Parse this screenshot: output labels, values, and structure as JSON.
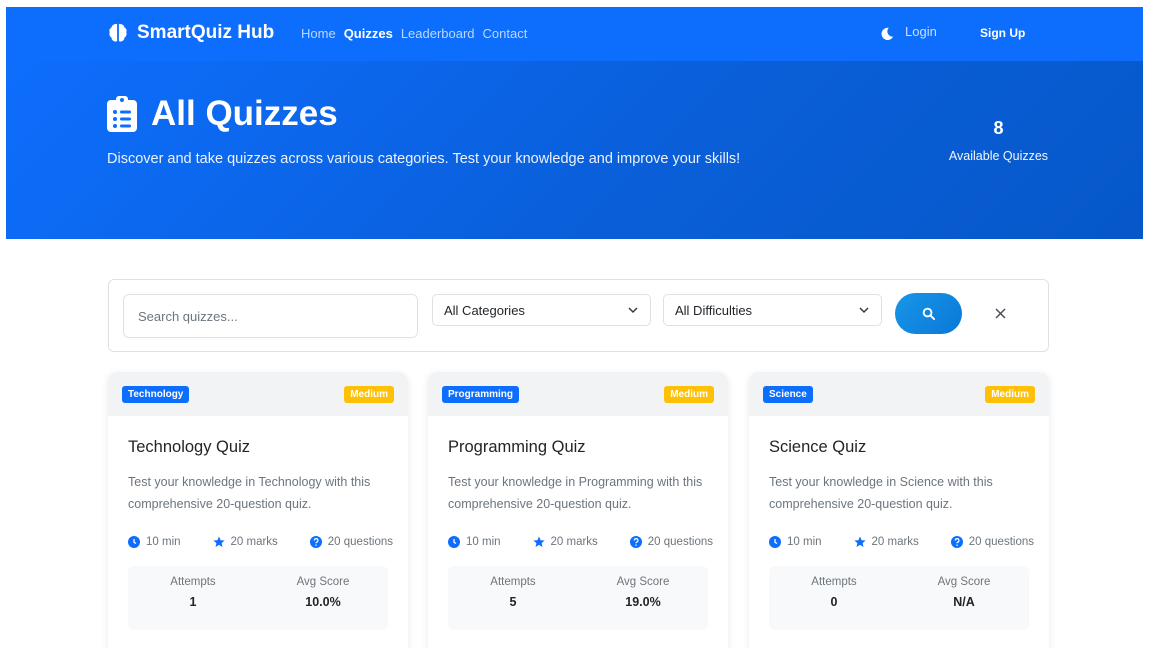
{
  "navbar": {
    "brand": "SmartQuiz Hub",
    "links": [
      {
        "label": "Home",
        "active": false
      },
      {
        "label": "Quizzes",
        "active": true
      },
      {
        "label": "Leaderboard",
        "active": false
      },
      {
        "label": "Contact",
        "active": false
      }
    ],
    "login": "Login",
    "signup": "Sign Up"
  },
  "hero": {
    "title": "All Quizzes",
    "description": "Discover and take quizzes across various categories. Test your knowledge and improve your skills!",
    "stat_value": "8",
    "stat_label": "Available Quizzes"
  },
  "filters": {
    "search_placeholder": "Search quizzes...",
    "category": "All Categories",
    "difficulty": "All Difficulties"
  },
  "quizzes": [
    {
      "category": "Technology",
      "difficulty": "Medium",
      "title": "Technology Quiz",
      "description": "Test your knowledge in Technology with this comprehensive 20-question quiz.",
      "duration": "10 min",
      "marks": "20 marks",
      "questions": "20 questions",
      "attempts_label": "Attempts",
      "attempts": "1",
      "avg_label": "Avg Score",
      "avg": "10.0%"
    },
    {
      "category": "Programming",
      "difficulty": "Medium",
      "title": "Programming Quiz",
      "description": "Test your knowledge in Programming with this comprehensive 20-question quiz.",
      "duration": "10 min",
      "marks": "20 marks",
      "questions": "20 questions",
      "attempts_label": "Attempts",
      "attempts": "5",
      "avg_label": "Avg Score",
      "avg": "19.0%"
    },
    {
      "category": "Science",
      "difficulty": "Medium",
      "title": "Science Quiz",
      "description": "Test your knowledge in Science with this comprehensive 20-question quiz.",
      "duration": "10 min",
      "marks": "20 marks",
      "questions": "20 questions",
      "attempts_label": "Attempts",
      "attempts": "0",
      "avg_label": "Avg Score",
      "avg": "N/A"
    }
  ],
  "colors": {
    "primary": "#0d6efd",
    "warning": "#ffc107",
    "muted": "#6c757d"
  }
}
